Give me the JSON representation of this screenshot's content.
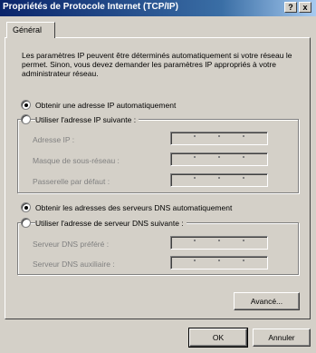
{
  "window": {
    "title": "Propriétés de Protocole Internet (TCP/IP)",
    "help_label": "?",
    "close_label": "x"
  },
  "tabs": [
    {
      "label": "Général",
      "active": true
    }
  ],
  "description": "Les paramètres IP peuvent être déterminés automatiquement si votre réseau le permet. Sinon, vous devez demander les paramètres IP appropriés à votre administrateur réseau.",
  "ip": {
    "auto_label": "Obtenir une adresse IP automatiquement",
    "auto_selected": true,
    "manual_label": "Utiliser l'adresse IP suivante :",
    "manual_selected": false,
    "fields": [
      {
        "label": "Adresse IP :",
        "value": ""
      },
      {
        "label": "Masque de sous-réseau :",
        "value": ""
      },
      {
        "label": "Passerelle par défaut :",
        "value": ""
      }
    ]
  },
  "dns": {
    "auto_label": "Obtenir les adresses des serveurs DNS automatiquement",
    "auto_selected": true,
    "manual_label": "Utiliser l'adresse de serveur DNS suivante :",
    "manual_selected": false,
    "fields": [
      {
        "label": "Serveur DNS préféré :",
        "value": ""
      },
      {
        "label": "Serveur DNS auxiliaire :",
        "value": ""
      }
    ]
  },
  "buttons": {
    "advanced": "Avancé...",
    "ok": "OK",
    "cancel": "Annuler"
  },
  "colors": {
    "title_start": "#0a246a",
    "title_end": "#a6caf0",
    "face": "#d4d0c8",
    "disabled_text": "#808080"
  }
}
